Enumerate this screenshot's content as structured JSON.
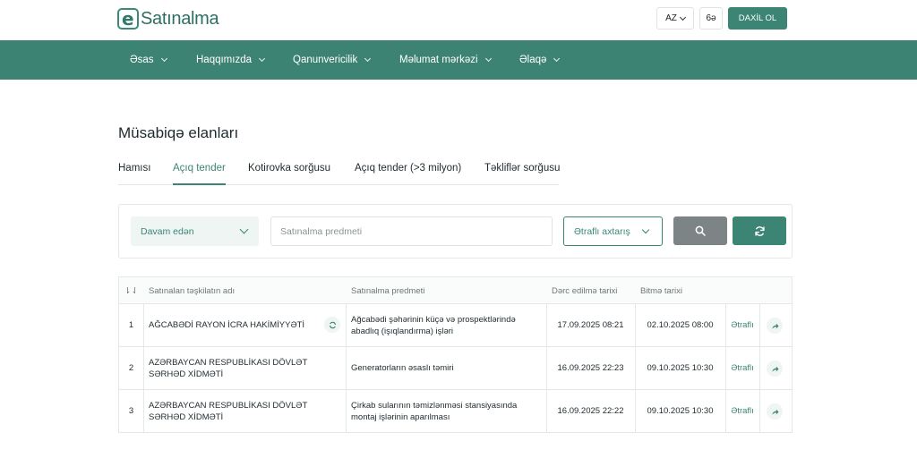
{
  "header": {
    "logo_text": "Satınalma",
    "lang": "AZ",
    "access_label": "6ə",
    "login_label": "DAXİL OL"
  },
  "nav": {
    "items": [
      {
        "label": "Əsas"
      },
      {
        "label": "Haqqımızda"
      },
      {
        "label": "Qanunvericilik"
      },
      {
        "label": "Məlumat mərkəzi"
      },
      {
        "label": "Əlaqə"
      }
    ]
  },
  "page": {
    "title": "Müsabiqə elanları"
  },
  "tabs": [
    {
      "label": "Hamısı",
      "active": false
    },
    {
      "label": "Açıq tender",
      "active": true
    },
    {
      "label": "Kotirovka sorğusu",
      "active": false
    },
    {
      "label": "Açıq tender (>3 milyon)",
      "active": false
    },
    {
      "label": "Təkliflər sorğusu",
      "active": false
    }
  ],
  "filters": {
    "status_value": "Davam edən",
    "subject_placeholder": "Satınalma predmeti",
    "advanced_label": "Ətraflı axtarış"
  },
  "table": {
    "columns": {
      "sort": "⇂⇃",
      "org": "Satınalan təşkilatın adı",
      "subject": "Satınalma predmeti",
      "published": "Dərc edilmə tarixi",
      "deadline": "Bitmə tarixi"
    },
    "rows": [
      {
        "num": "1",
        "org": "AĞCABƏDİ RAYON İCRA HAKİMİYYƏTİ",
        "subject": "Ağcabədi şəhərinin küçə və prospektlərində abadlıq (işıqlandırma) işləri",
        "published": "17.09.2025 08:21",
        "deadline": "02.10.2025 08:00",
        "more": "Ətraflı"
      },
      {
        "num": "2",
        "org": "AZƏRBAYCAN RESPUBLİKASI DÖVLƏT SƏRHƏD XİDMƏTİ",
        "subject": "Generatorların əsaslı təmiri",
        "published": "16.09.2025 22:23",
        "deadline": "09.10.2025 10:30",
        "more": "Ətraflı"
      },
      {
        "num": "3",
        "org": "AZƏRBAYCAN RESPUBLİKASI DÖVLƏT SƏRHƏD XİDMƏTİ",
        "subject": "Çirkab sularının təmizlənməsi stansiyasında montaj işlərinin aparılması",
        "published": "16.09.2025 22:22",
        "deadline": "09.10.2025 10:30",
        "more": "Ətraflı"
      }
    ]
  },
  "colors": {
    "brand": "#3d8374",
    "search_button": "#7d8486"
  }
}
